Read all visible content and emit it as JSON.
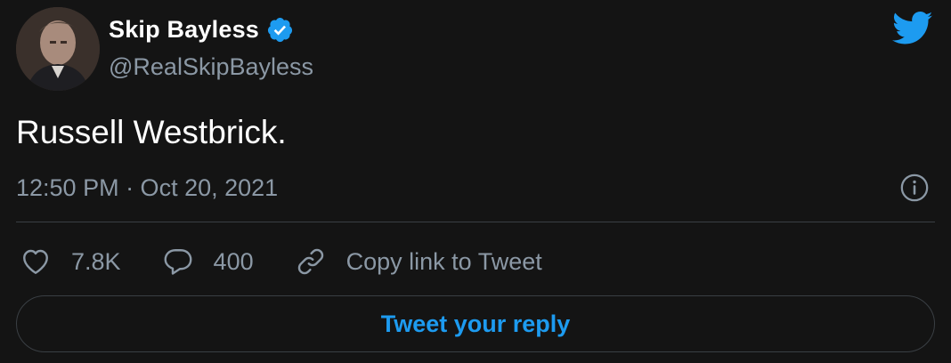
{
  "user": {
    "display_name": "Skip Bayless",
    "handle": "@RealSkipBayless",
    "verified": true,
    "avatar_icon": "avatar-photo"
  },
  "brand": {
    "logo_icon": "twitter-bird-icon",
    "accent": "#1d9bf0"
  },
  "tweet": {
    "text": "Russell Westbrick.",
    "timestamp": "12:50 PM · Oct 20, 2021"
  },
  "actions": {
    "likes": {
      "icon": "heart-icon",
      "count": "7.8K"
    },
    "replies": {
      "icon": "speech-bubble-icon",
      "count": "400"
    },
    "copy_link": {
      "icon": "link-icon",
      "label": "Copy link to Tweet"
    }
  },
  "info": {
    "icon": "info-icon"
  },
  "reply": {
    "label": "Tweet your reply"
  },
  "colors": {
    "background": "#141414",
    "text_primary": "#ffffff",
    "text_secondary": "#8b98a5",
    "divider": "#3a3f44"
  }
}
